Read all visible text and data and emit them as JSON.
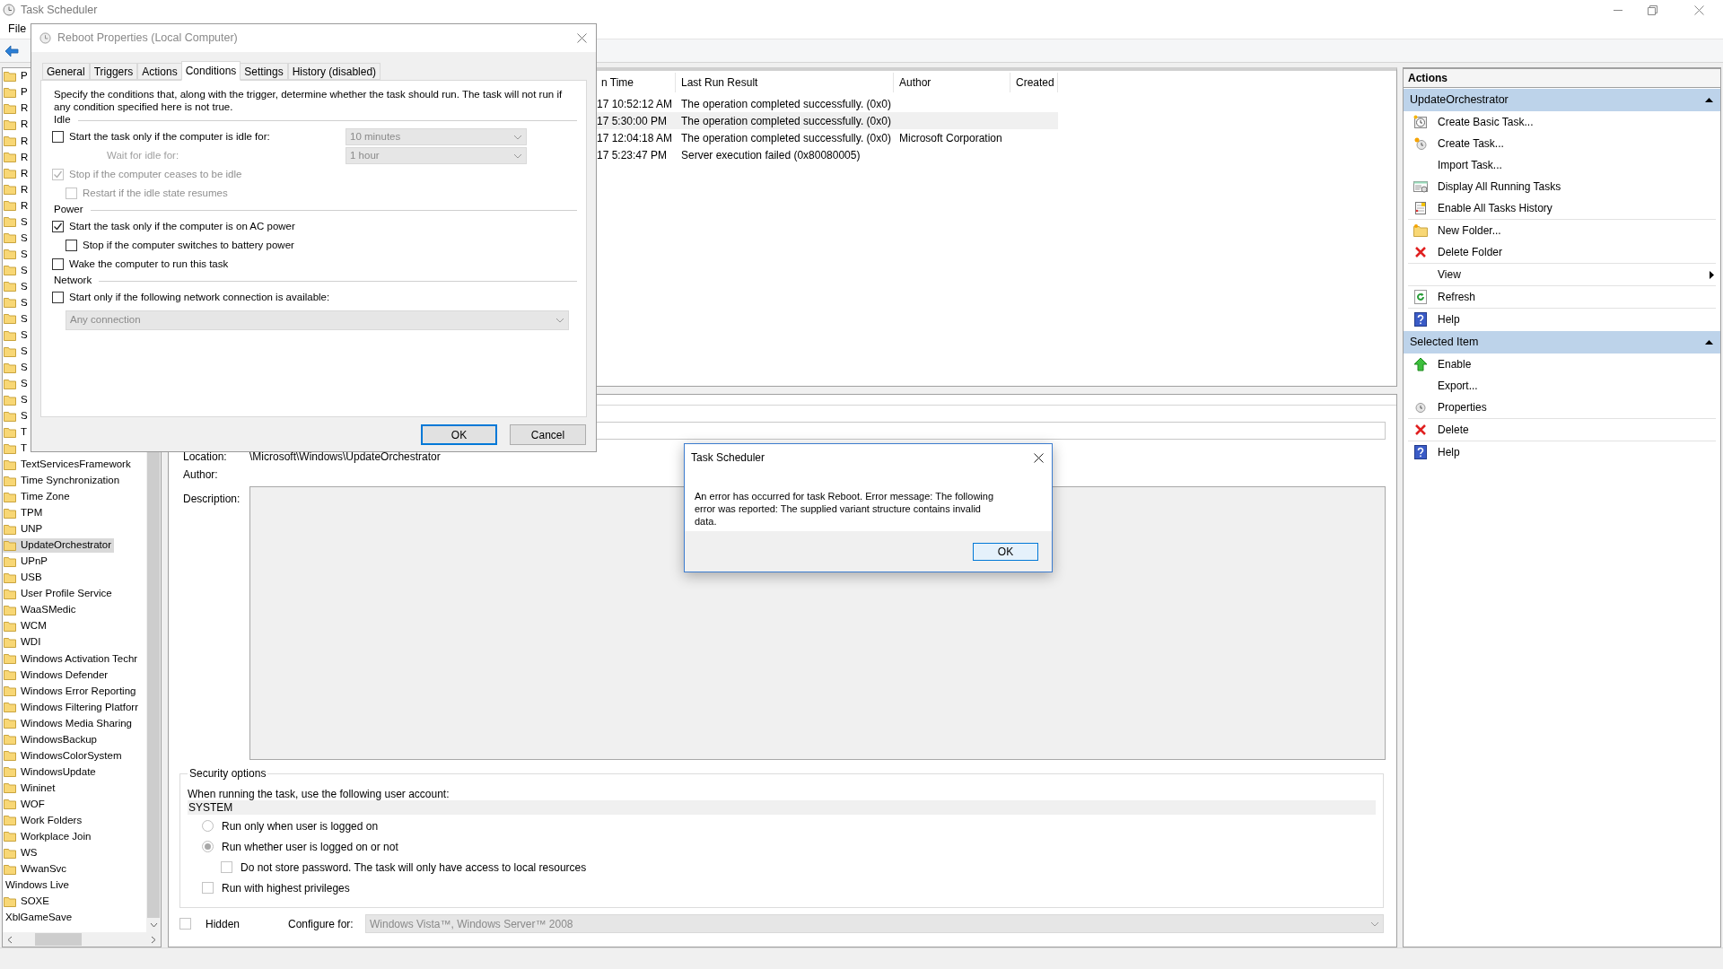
{
  "main_window": {
    "title": "Task Scheduler",
    "menu": [
      "File"
    ]
  },
  "tree": {
    "items": [
      {
        "label": "P",
        "kind": "folder",
        "selected": false
      },
      {
        "label": "P",
        "kind": "folder",
        "selected": false
      },
      {
        "label": "R",
        "kind": "folder",
        "selected": false
      },
      {
        "label": "R",
        "kind": "folder",
        "selected": false
      },
      {
        "label": "R",
        "kind": "folder",
        "selected": false
      },
      {
        "label": "R",
        "kind": "folder",
        "selected": false
      },
      {
        "label": "R",
        "kind": "folder",
        "selected": false
      },
      {
        "label": "R",
        "kind": "folder",
        "selected": false
      },
      {
        "label": "R",
        "kind": "folder",
        "selected": false
      },
      {
        "label": "S",
        "kind": "folder",
        "selected": false
      },
      {
        "label": "S",
        "kind": "folder",
        "selected": false
      },
      {
        "label": "S",
        "kind": "folder",
        "selected": false
      },
      {
        "label": "S",
        "kind": "folder",
        "selected": false
      },
      {
        "label": "S",
        "kind": "folder",
        "selected": false
      },
      {
        "label": "S",
        "kind": "folder",
        "selected": false
      },
      {
        "label": "S",
        "kind": "folder",
        "selected": false
      },
      {
        "label": "S",
        "kind": "folder",
        "selected": false
      },
      {
        "label": "S",
        "kind": "folder",
        "selected": false
      },
      {
        "label": "S",
        "kind": "folder",
        "selected": false
      },
      {
        "label": "S",
        "kind": "folder",
        "selected": false
      },
      {
        "label": "S",
        "kind": "folder",
        "selected": false
      },
      {
        "label": "S",
        "kind": "folder",
        "selected": false
      },
      {
        "label": "T",
        "kind": "folder",
        "selected": false
      },
      {
        "label": "T",
        "kind": "folder",
        "selected": false
      },
      {
        "label": "TextServicesFramework",
        "kind": "folder",
        "selected": false
      },
      {
        "label": "Time Synchronization",
        "kind": "folder",
        "selected": false
      },
      {
        "label": "Time Zone",
        "kind": "folder",
        "selected": false
      },
      {
        "label": "TPM",
        "kind": "folder",
        "selected": false
      },
      {
        "label": "UNP",
        "kind": "folder",
        "selected": false
      },
      {
        "label": "UpdateOrchestrator",
        "kind": "folder",
        "selected": true
      },
      {
        "label": "UPnP",
        "kind": "folder",
        "selected": false
      },
      {
        "label": "USB",
        "kind": "folder",
        "selected": false
      },
      {
        "label": "User Profile Service",
        "kind": "folder",
        "selected": false
      },
      {
        "label": "WaaSMedic",
        "kind": "folder",
        "selected": false
      },
      {
        "label": "WCM",
        "kind": "folder",
        "selected": false
      },
      {
        "label": "WDI",
        "kind": "folder",
        "selected": false
      },
      {
        "label": "Windows Activation Techr",
        "kind": "folder",
        "selected": false
      },
      {
        "label": "Windows Defender",
        "kind": "folder",
        "selected": false
      },
      {
        "label": "Windows Error Reporting",
        "kind": "folder",
        "selected": false
      },
      {
        "label": "Windows Filtering Platforr",
        "kind": "folder",
        "selected": false
      },
      {
        "label": "Windows Media Sharing",
        "kind": "folder",
        "selected": false
      },
      {
        "label": "WindowsBackup",
        "kind": "folder",
        "selected": false
      },
      {
        "label": "WindowsColorSystem",
        "kind": "folder",
        "selected": false
      },
      {
        "label": "WindowsUpdate",
        "kind": "folder",
        "selected": false
      },
      {
        "label": "Wininet",
        "kind": "folder",
        "selected": false
      },
      {
        "label": "WOF",
        "kind": "folder",
        "selected": false
      },
      {
        "label": "Work Folders",
        "kind": "folder",
        "selected": false
      },
      {
        "label": "Workplace Join",
        "kind": "folder",
        "selected": false
      },
      {
        "label": "WS",
        "kind": "folder",
        "selected": false
      },
      {
        "label": "WwanSvc",
        "kind": "folder",
        "selected": false
      },
      {
        "label": "Windows Live",
        "kind": "plain",
        "selected": false
      },
      {
        "label": "SOXE",
        "kind": "folder",
        "selected": false
      },
      {
        "label": "XblGameSave",
        "kind": "plain",
        "selected": false
      }
    ]
  },
  "task_list": {
    "columns": [
      "n Time",
      "Last Run Result",
      "Author",
      "Created"
    ],
    "rows": [
      {
        "time": "17 10:52:12 AM",
        "result": "The operation completed successfully. (0x0)",
        "selected": false
      },
      {
        "time": "17 5:30:00 PM",
        "result": "The operation completed successfully. (0x0)",
        "selected": true
      },
      {
        "time": "17 12:04:18 AM",
        "result": "The operation completed successfully. (0x0)",
        "author": "Microsoft Corporation",
        "selected": false
      },
      {
        "time": "17 5:23:47 PM",
        "result": "Server execution failed (0x80080005)",
        "selected": false
      }
    ]
  },
  "task_details": {
    "location_label": "Location:",
    "location": "\\Microsoft\\Windows\\UpdateOrchestrator",
    "author_label": "Author:",
    "description_label": "Description:",
    "security": {
      "title": "Security options",
      "account_label": "When running the task, use the following user account:",
      "account": "SYSTEM",
      "options": [
        {
          "kind": "radio",
          "label": "Run only when user is logged on",
          "selected": false
        },
        {
          "kind": "radio",
          "label": "Run whether user is logged on or not",
          "selected": true,
          "children": [
            {
              "kind": "checkbox",
              "label": "Do not store password.  The task will only have access to local resources",
              "checked": false
            }
          ]
        },
        {
          "kind": "checkbox",
          "label": "Run with highest privileges",
          "checked": false
        }
      ]
    },
    "hidden": {
      "label": "Hidden",
      "checked": false
    },
    "configure": {
      "label": "Configure for:",
      "value": "Windows Vista™, Windows Server™ 2008"
    }
  },
  "actions": {
    "title": "Actions",
    "groups": [
      {
        "title": "UpdateOrchestrator",
        "expanded": true,
        "items": [
          {
            "label": "Create Basic Task...",
            "kind": "action"
          },
          {
            "label": "Create Task...",
            "kind": "action"
          },
          {
            "label": "Import Task...",
            "kind": "action"
          },
          {
            "label": "Display All Running Tasks",
            "kind": "action"
          },
          {
            "label": "Enable All Tasks History",
            "kind": "action"
          },
          {
            "label": "New Folder...",
            "kind": "action"
          },
          {
            "label": "Delete Folder",
            "kind": "action"
          },
          {
            "label": "View",
            "kind": "submenu"
          },
          {
            "label": "Refresh",
            "kind": "action"
          },
          {
            "label": "Help",
            "kind": "action"
          }
        ]
      },
      {
        "title": "Selected Item",
        "expanded": true,
        "items": [
          {
            "label": "Enable",
            "kind": "action"
          },
          {
            "label": "Export...",
            "kind": "action"
          },
          {
            "label": "Properties",
            "kind": "action"
          },
          {
            "label": "Delete",
            "kind": "action"
          },
          {
            "label": "Help",
            "kind": "action"
          }
        ]
      }
    ]
  },
  "dialog": {
    "title": "Reboot Properties (Local Computer)",
    "tabs": [
      {
        "label": "General",
        "selected": false
      },
      {
        "label": "Triggers",
        "selected": false
      },
      {
        "label": "Actions",
        "selected": false
      },
      {
        "label": "Conditions",
        "selected": true
      },
      {
        "label": "Settings",
        "selected": false
      },
      {
        "label": "History (disabled)",
        "selected": false
      }
    ],
    "description": "Specify the conditions that, along with the trigger, determine whether the task should run.  The task will not run  if any condition specified here is not true.",
    "sections": [
      {
        "title": "Idle",
        "rows": [
          {
            "kind": "checkbox",
            "label": "Start the task only if the computer is idle for:",
            "checked": false,
            "disabled": false,
            "dropdown": {
              "value": "10 minutes",
              "disabled": true
            }
          },
          {
            "kind": "label",
            "label": "Wait for idle for:",
            "disabled": true,
            "dropdown": {
              "value": "1 hour",
              "disabled": true
            }
          },
          {
            "kind": "checkbox",
            "label": "Stop if the computer ceases to be idle",
            "checked": true,
            "disabled": true,
            "children": [
              {
                "kind": "checkbox",
                "label": "Restart if the idle state resumes",
                "checked": false,
                "disabled": true
              }
            ]
          }
        ]
      },
      {
        "title": "Power",
        "rows": [
          {
            "kind": "checkbox",
            "label": "Start the task only if the computer is on AC power",
            "checked": true,
            "disabled": false,
            "children": [
              {
                "kind": "checkbox",
                "label": "Stop if the computer switches to battery power",
                "checked": false,
                "disabled": false
              }
            ]
          },
          {
            "kind": "checkbox",
            "label": "Wake the computer to run this task",
            "checked": false,
            "disabled": false
          }
        ]
      },
      {
        "title": "Network",
        "rows": [
          {
            "kind": "checkbox",
            "label": "Start only if the following network connection is available:",
            "checked": false,
            "disabled": false
          },
          {
            "kind": "dropdown",
            "dropdown": {
              "value": "Any connection",
              "disabled": true
            }
          }
        ]
      }
    ],
    "buttons": [
      {
        "label": "OK",
        "default": true
      },
      {
        "label": "Cancel",
        "default": false
      }
    ]
  },
  "message_box": {
    "title": "Task Scheduler",
    "message": "An error has occurred for task Reboot. Error message: The following error was reported: The supplied variant structure contains invalid data.",
    "button": "OK"
  }
}
